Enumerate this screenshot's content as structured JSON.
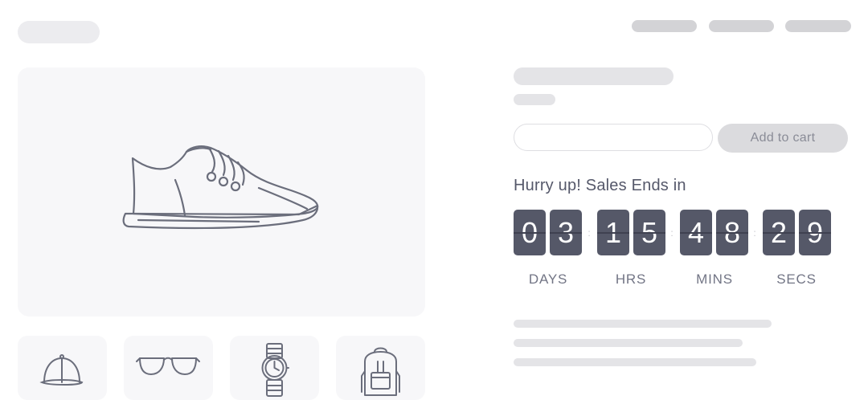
{
  "header": {
    "logo": "",
    "nav": [
      "",
      "",
      ""
    ]
  },
  "gallery": {
    "main_image_icon": "sneaker-icon",
    "thumbnails": [
      {
        "icon": "cap-icon"
      },
      {
        "icon": "sunglasses-icon"
      },
      {
        "icon": "wristwatch-icon"
      },
      {
        "icon": "backpack-icon"
      }
    ]
  },
  "product": {
    "quantity_value": "",
    "quantity_placeholder": "",
    "add_to_cart_label": "Add to cart"
  },
  "countdown": {
    "heading": "Hurry up! Sales Ends in",
    "days": [
      "0",
      "3"
    ],
    "hours": [
      "1",
      "5"
    ],
    "minutes": [
      "4",
      "8"
    ],
    "seconds": [
      "2",
      "9"
    ],
    "labels": {
      "days": "DAYS",
      "hours": "HRS",
      "minutes": "MINS",
      "seconds": "SECS"
    },
    "separator": ":"
  },
  "colors": {
    "digit_tile": "#555868",
    "skeleton": "#e4e4e7",
    "button_bg": "#dbdbde",
    "text": "#55586a"
  }
}
